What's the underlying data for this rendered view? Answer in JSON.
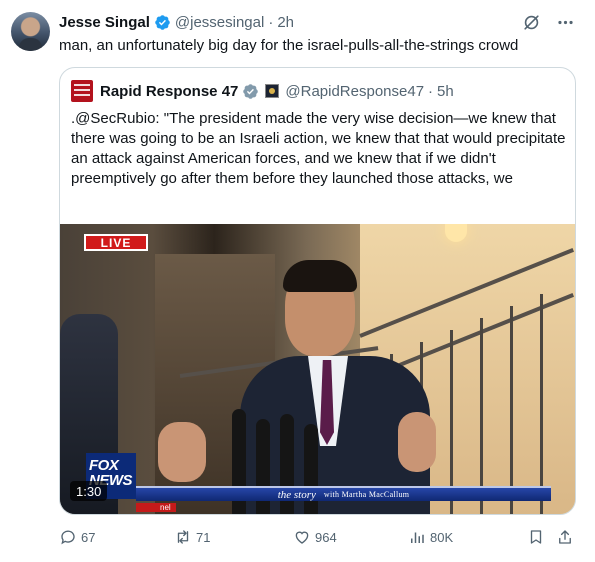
{
  "post": {
    "author_name": "Jesse Singal",
    "author_handle": "@jessesingal",
    "separator": "·",
    "time": "2h",
    "text": "man, an unfortunately big day for the israel-pulls-all-the-strings crowd",
    "icons": [
      "grok-icon",
      "more-icon"
    ]
  },
  "quote": {
    "author_name": "Rapid Response 47",
    "author_handle": "@RapidResponse47",
    "separator": "·",
    "time": "5h",
    "text": ".@SecRubio: \"The president made the very wise decision—we knew that there was going to be an Israeli action, we knew that that would precipitate an attack against American forces, and we knew that if we didn't preemptively go after them before they launched those attacks, we",
    "video": {
      "live_label": "LIVE",
      "network_logo_line1": "FOX",
      "network_logo_line2": "NEWS",
      "chyron_show": "the story",
      "chyron_host": "with Martha MacCallum",
      "channel_label": "nel",
      "duration": "1:30"
    }
  },
  "actions": {
    "replies": "67",
    "reposts": "71",
    "likes": "964",
    "views": "80K"
  },
  "colors": {
    "verified_blue": "#1d9bf0",
    "secondary_text": "#536471",
    "border": "#cfd9de"
  }
}
